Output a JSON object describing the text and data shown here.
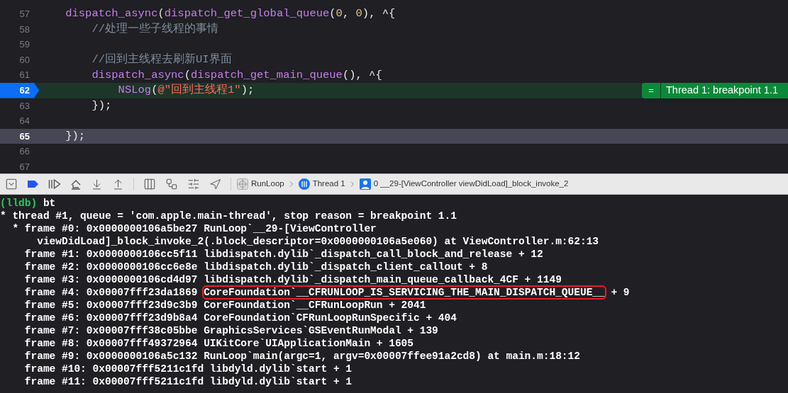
{
  "editor": {
    "lines": [
      {
        "number": "57",
        "current": false,
        "breakpoint": false,
        "tokens": [
          {
            "text": "    dispatch_async",
            "kind": "func"
          },
          {
            "text": "(",
            "kind": "plain"
          },
          {
            "text": "dispatch_get_global_queue",
            "kind": "func"
          },
          {
            "text": "(",
            "kind": "plain"
          },
          {
            "text": "0",
            "kind": "number"
          },
          {
            "text": ", ",
            "kind": "plain"
          },
          {
            "text": "0",
            "kind": "number"
          },
          {
            "text": "), ^{",
            "kind": "plain"
          }
        ]
      },
      {
        "number": "58",
        "current": false,
        "breakpoint": false,
        "tokens": [
          {
            "text": "        //处理一些子线程的事情",
            "kind": "comment"
          }
        ]
      },
      {
        "number": "59",
        "current": false,
        "breakpoint": false
      },
      {
        "number": "60",
        "current": false,
        "breakpoint": false,
        "tokens": [
          {
            "text": "        //回到主线程去刷新UI界面",
            "kind": "comment"
          }
        ]
      },
      {
        "number": "61",
        "current": false,
        "breakpoint": false,
        "tokens": [
          {
            "text": "        dispatch_async",
            "kind": "func"
          },
          {
            "text": "(",
            "kind": "plain"
          },
          {
            "text": "dispatch_get_main_queue",
            "kind": "func"
          },
          {
            "text": "(), ^{",
            "kind": "plain"
          }
        ]
      },
      {
        "number": "62",
        "current": false,
        "breakpoint": true,
        "tokens": [
          {
            "text": "            NSLog",
            "kind": "func"
          },
          {
            "text": "(",
            "kind": "plain"
          },
          {
            "text": "@\"回到主线程1\"",
            "kind": "string"
          },
          {
            "text": ");",
            "kind": "plain"
          }
        ],
        "annotation": {
          "icon": "=",
          "text": "Thread 1: breakpoint 1.1"
        }
      },
      {
        "number": "63",
        "current": false,
        "breakpoint": false,
        "tokens": [
          {
            "text": "        });",
            "kind": "plain"
          }
        ]
      },
      {
        "number": "64",
        "current": false,
        "breakpoint": false
      },
      {
        "number": "65",
        "current": true,
        "breakpoint": false,
        "tokens": [
          {
            "text": "    });",
            "kind": "plain"
          }
        ]
      },
      {
        "number": "66",
        "current": false,
        "breakpoint": false
      },
      {
        "number": "67",
        "current": false,
        "breakpoint": false
      }
    ]
  },
  "debug_bar": {
    "breadcrumbs": [
      {
        "kind": "app",
        "label": "RunLoop"
      },
      {
        "kind": "thread",
        "label": "Thread 1"
      },
      {
        "kind": "frame",
        "label": "0 __29-[ViewController viewDidLoad]_block_invoke_2"
      }
    ]
  },
  "console": {
    "lines": [
      [
        {
          "text": "(lldb)",
          "kind": "prompt"
        },
        {
          "text": " bt",
          "kind": "plain"
        }
      ],
      [
        {
          "text": "* thread #1, queue = 'com.apple.main-thread', stop reason = breakpoint 1.1",
          "kind": "plain"
        }
      ],
      [
        {
          "text": "  * frame #0: 0x0000000106a5be27 RunLoop`__29-[ViewController",
          "kind": "plain"
        }
      ],
      [
        {
          "text": "      viewDidLoad]_block_invoke_2(.block_descriptor=0x0000000106a5e060) at ViewController.m:62:13",
          "kind": "plain"
        }
      ],
      [
        {
          "text": "    frame #1: 0x0000000106cc5f11 libdispatch.dylib`_dispatch_call_block_and_release + 12",
          "kind": "plain"
        }
      ],
      [
        {
          "text": "    frame #2: 0x0000000106cc6e8e libdispatch.dylib`_dispatch_client_callout + 8",
          "kind": "plain"
        }
      ],
      [
        {
          "text": "    frame #3: 0x0000000106cd4d97 libdispatch.dylib`_dispatch_main_queue_callback_4CF + 1149",
          "kind": "plain"
        }
      ],
      [
        {
          "text": "    frame #4: 0x00007fff23da1869 ",
          "kind": "plain"
        },
        {
          "text": "CoreFoundation`__CFRUNLOOP_IS_SERVICING_THE_MAIN_DISPATCH_QUEUE__",
          "kind": "boxed"
        },
        {
          "text": " + 9",
          "kind": "plain"
        }
      ],
      [
        {
          "text": "    frame #5: 0x00007fff23d9c3b9 CoreFoundation`__CFRunLoopRun + 2041",
          "kind": "plain"
        }
      ],
      [
        {
          "text": "    frame #6: 0x00007fff23d9b8a4 CoreFoundation`CFRunLoopRunSpecific + 404",
          "kind": "plain"
        }
      ],
      [
        {
          "text": "    frame #7: 0x00007fff38c05bbe GraphicsServices`GSEventRunModal + 139",
          "kind": "plain"
        }
      ],
      [
        {
          "text": "    frame #8: 0x00007fff49372964 UIKitCore`UIApplicationMain + 1605",
          "kind": "plain"
        }
      ],
      [
        {
          "text": "    frame #9: 0x0000000106a5c132 RunLoop`main(argc=1, argv=0x00007ffee91a2cd8) at main.m:18:12",
          "kind": "plain"
        }
      ],
      [
        {
          "text": "    frame #10: 0x00007fff5211c1fd libdyld.dylib`start + 1",
          "kind": "plain"
        }
      ],
      [
        {
          "text": "    frame #11: 0x00007fff5211c1fd libdyld.dylib`start + 1",
          "kind": "plain"
        }
      ]
    ]
  }
}
